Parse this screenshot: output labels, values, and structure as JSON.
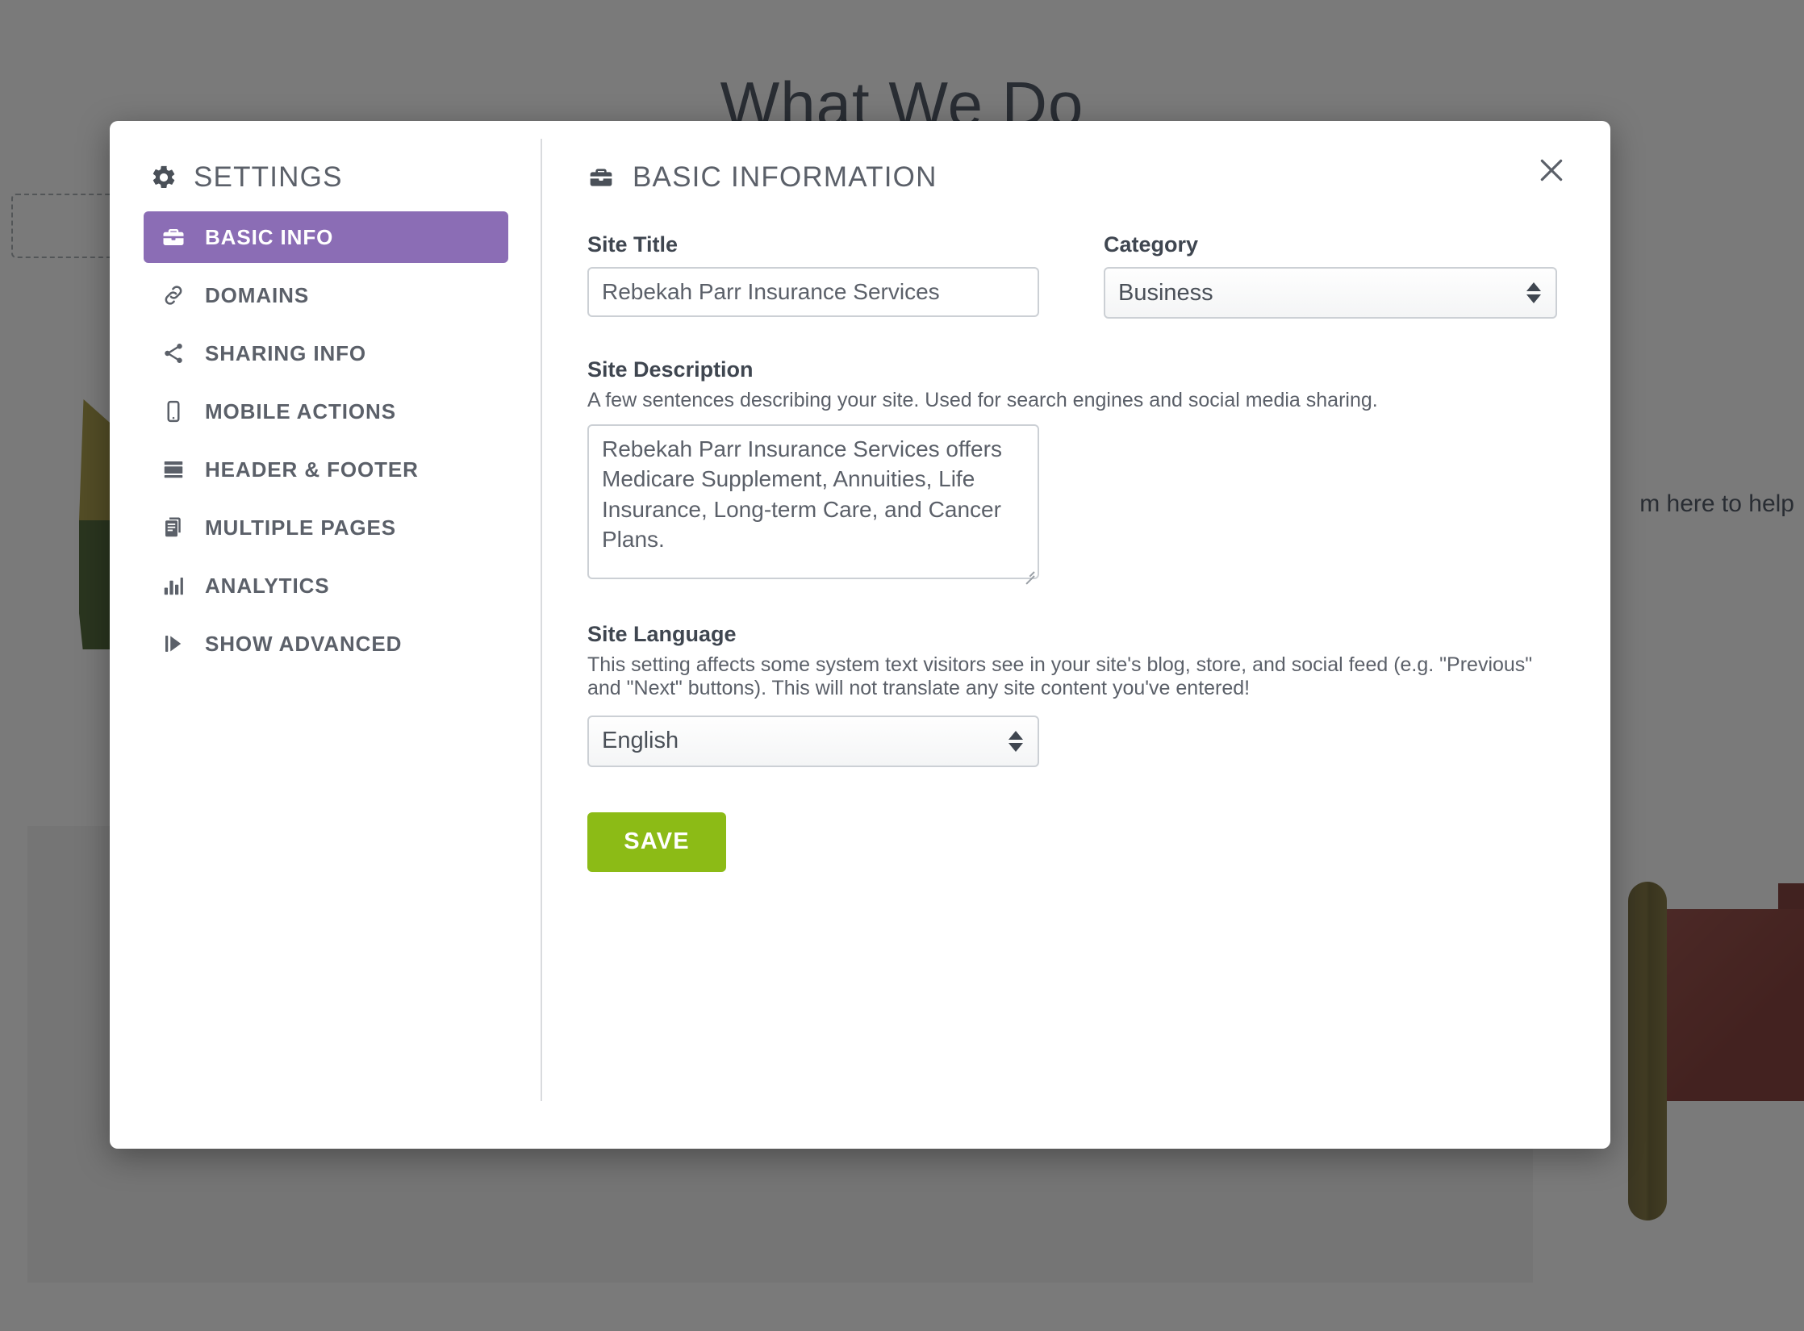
{
  "background": {
    "hero_title": "What We Do",
    "sub_text": "m here to help"
  },
  "modal": {
    "sidebar": {
      "heading": "SETTINGS",
      "heading_icon": "gear-icon",
      "items": [
        {
          "label": "BASIC INFO",
          "icon": "briefcase-icon",
          "active": true
        },
        {
          "label": "DOMAINS",
          "icon": "link-icon",
          "active": false
        },
        {
          "label": "SHARING INFO",
          "icon": "share-icon",
          "active": false
        },
        {
          "label": "MOBILE ACTIONS",
          "icon": "mobile-icon",
          "active": false
        },
        {
          "label": "HEADER & FOOTER",
          "icon": "layout-icon",
          "active": false
        },
        {
          "label": "MULTIPLE PAGES",
          "icon": "pages-icon",
          "active": false
        },
        {
          "label": "ANALYTICS",
          "icon": "bar-chart-icon",
          "active": false
        },
        {
          "label": "SHOW ADVANCED",
          "icon": "play-forward-icon",
          "active": false
        }
      ]
    },
    "main": {
      "title": "BASIC INFORMATION",
      "title_icon": "briefcase-icon",
      "close_icon": "close-icon",
      "site_title": {
        "label": "Site Title",
        "value": "Rebekah Parr Insurance Services"
      },
      "category": {
        "label": "Category",
        "value": "Business"
      },
      "site_description": {
        "label": "Site Description",
        "help": "A few sentences describing your site. Used for search engines and social media sharing.",
        "value": "Rebekah Parr Insurance Services offers Medicare Supplement, Annuities, Life Insurance, Long-term Care, and Cancer Plans."
      },
      "site_language": {
        "label": "Site Language",
        "help": "This setting affects some system text visitors see in your site's blog, store, and social feed (e.g. \"Previous\" and \"Next\" buttons). This will not translate any site content you've entered!",
        "value": "English"
      },
      "save_label": "SAVE"
    }
  },
  "colors": {
    "accent_purple": "#8b6db5",
    "save_green": "#8cbb16",
    "text_gray": "#5b6069",
    "border_gray": "#ccd0d5"
  }
}
